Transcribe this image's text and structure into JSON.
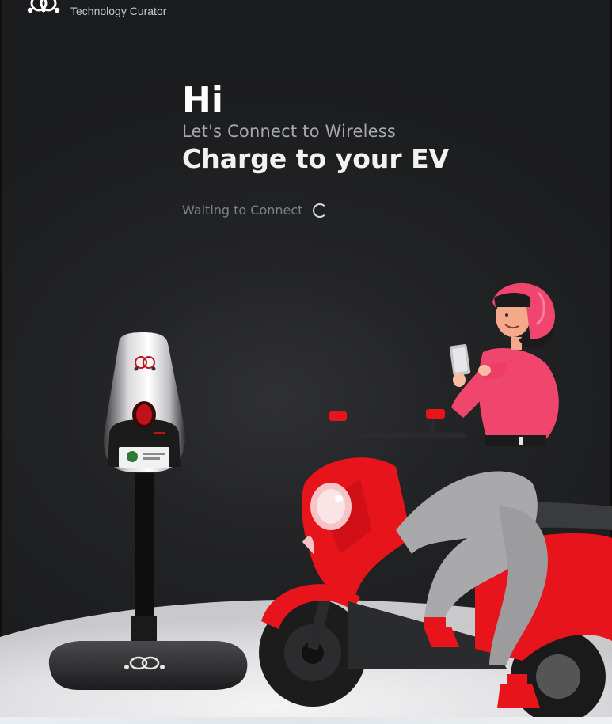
{
  "header": {
    "logo_icon": "network-knot-logo",
    "tagline": "Technology Curator"
  },
  "hero": {
    "greeting": "Hi",
    "subtitle": "Let's Connect to Wireless",
    "headline": "Charge to your EV"
  },
  "status": {
    "text": "Waiting to Connect",
    "spinner_icon": "loading-spinner-icon"
  },
  "illustration": {
    "charger_icon": "ev-charger-stand-icon",
    "rider_icon": "rider-on-scooter-icon",
    "colors": {
      "background": "#1d1e20",
      "accent_red": "#e8141b",
      "jacket_pink": "#f0466e",
      "floor": "#e6e6e8"
    }
  }
}
